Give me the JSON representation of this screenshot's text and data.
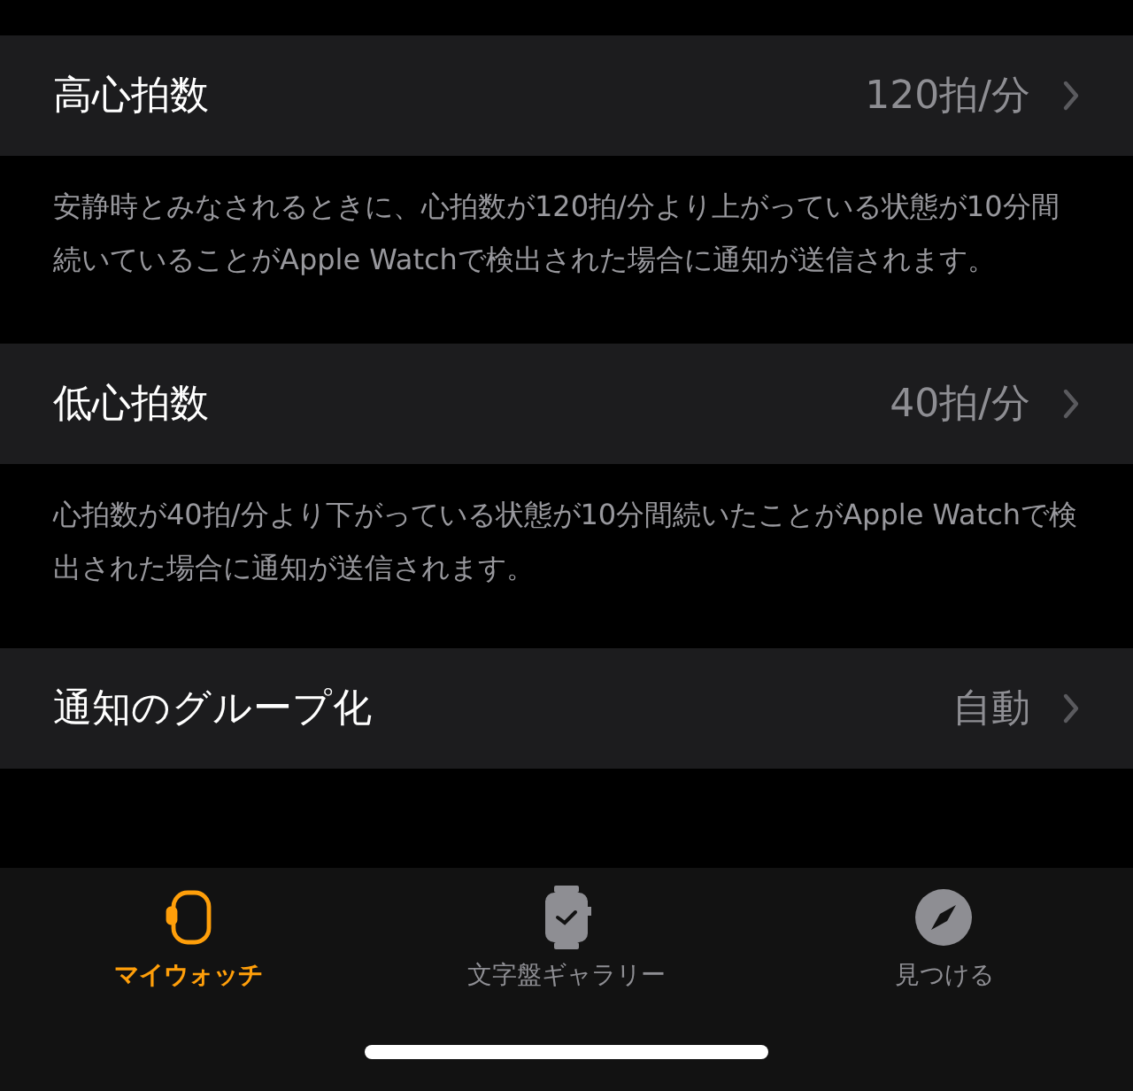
{
  "sections": [
    {
      "label": "高心拍数",
      "value": "120拍/分",
      "footer": "安静時とみなされるときに、心拍数が120拍/分より上がっている状態が10分間続いていることがApple Watchで検出された場合に通知が送信されます。"
    },
    {
      "label": "低心拍数",
      "value": "40拍/分",
      "footer": "心拍数が40拍/分より下がっている状態が10分間続いたことがApple Watchで検出された場合に通知が送信されます。"
    },
    {
      "label": "通知のグループ化",
      "value": "自動"
    }
  ],
  "tabs": [
    {
      "label": "マイウォッチ",
      "kind": "watch",
      "selected": true
    },
    {
      "label": "文字盤ギャラリー",
      "kind": "face",
      "selected": false
    },
    {
      "label": "見つける",
      "kind": "compass",
      "selected": false
    }
  ]
}
